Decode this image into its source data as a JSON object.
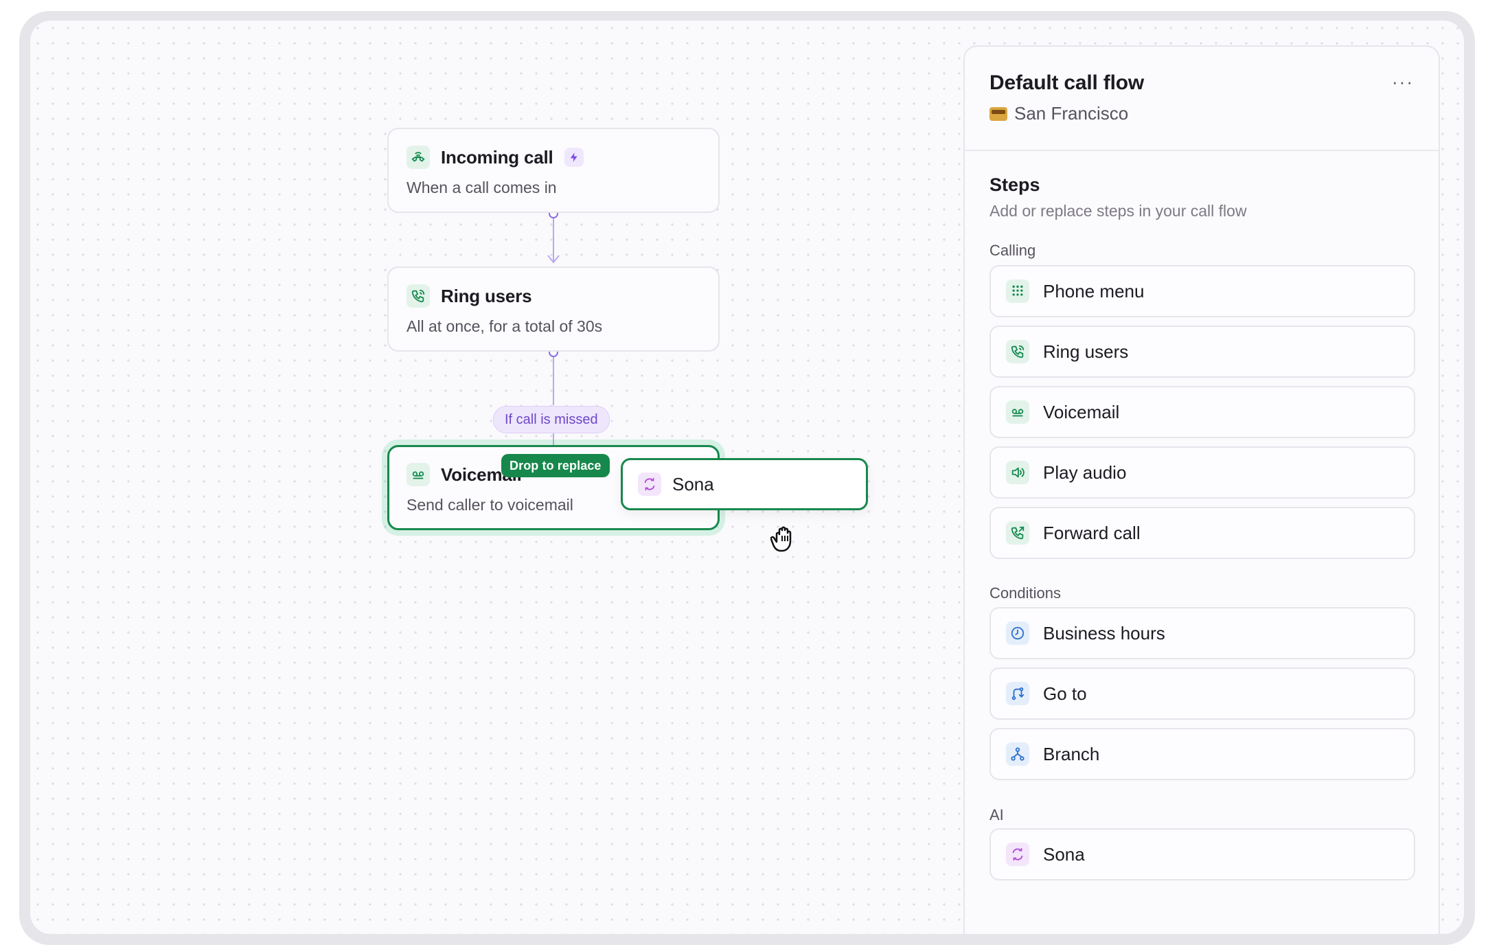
{
  "canvas": {
    "nodes": [
      {
        "title": "Incoming call",
        "subtitle": "When a call comes in",
        "icon": "incoming-call-icon",
        "trigger_icon": "bolt-icon"
      },
      {
        "title": "Ring users",
        "subtitle": "All at once, for a total of 30s",
        "icon": "phone-ring-icon"
      },
      {
        "title": "Voicemail",
        "subtitle": "Send caller to voicemail",
        "icon": "voicemail-icon"
      }
    ],
    "branch_label": "If call is missed",
    "drop_label": "Drop to replace",
    "drag_item": {
      "label": "Sona",
      "icon": "sona-ai-icon"
    }
  },
  "panel": {
    "title": "Default call flow",
    "location_emoji": "tram-icon",
    "location": "San Francisco",
    "more_label": "···",
    "steps_title": "Steps",
    "steps_subtitle": "Add or replace steps in your call flow",
    "sections": [
      {
        "label": "Calling",
        "items": [
          {
            "label": "Phone menu",
            "icon": "keypad-grid-icon"
          },
          {
            "label": "Ring users",
            "icon": "phone-ring-icon"
          },
          {
            "label": "Voicemail",
            "icon": "voicemail-icon"
          },
          {
            "label": "Play audio",
            "icon": "speaker-icon"
          },
          {
            "label": "Forward call",
            "icon": "phone-forward-icon"
          }
        ]
      },
      {
        "label": "Conditions",
        "items": [
          {
            "label": "Business hours",
            "icon": "clock-icon"
          },
          {
            "label": "Go to",
            "icon": "route-icon"
          },
          {
            "label": "Branch",
            "icon": "branch-icon"
          }
        ]
      },
      {
        "label": "AI",
        "items": [
          {
            "label": "Sona",
            "icon": "sona-ai-icon"
          }
        ]
      }
    ]
  },
  "colors": {
    "accent_green": "#17884c",
    "accent_purple": "#6d46c9",
    "canvas_bg": "#faf9fc"
  }
}
